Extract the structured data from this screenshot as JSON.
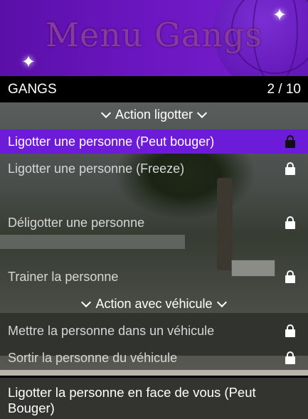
{
  "banner": {
    "title": "Menu Gangs"
  },
  "subheader": {
    "title": "GANGS",
    "counter": "2 / 10"
  },
  "rows": [
    {
      "label": "Action ligotter",
      "type": "separator"
    },
    {
      "label": "Ligotter une personne (Peut bouger)",
      "type": "item",
      "selected": true,
      "icon": "lock-icon"
    },
    {
      "label": "Ligotter une personne (Freeze)",
      "type": "item",
      "icon": "lock-icon"
    },
    {
      "label": "Déligotter une personne",
      "type": "item",
      "icon": "lock-icon"
    },
    {
      "label": "Trainer la personne",
      "type": "item",
      "icon": "lock-icon"
    },
    {
      "label": "Action avec véhicule",
      "type": "separator"
    },
    {
      "label": "Mettre la personne dans un véhicule",
      "type": "item",
      "icon": "lock-icon"
    },
    {
      "label": "Sortir la personne du véhicule",
      "type": "item",
      "icon": "lock-icon"
    }
  ],
  "description": "Ligotter la personne en face de vous (Peut Bouger)",
  "colors": {
    "accent": "#6c1bd8",
    "banner": "#5b0fa8",
    "header": "#000000"
  }
}
